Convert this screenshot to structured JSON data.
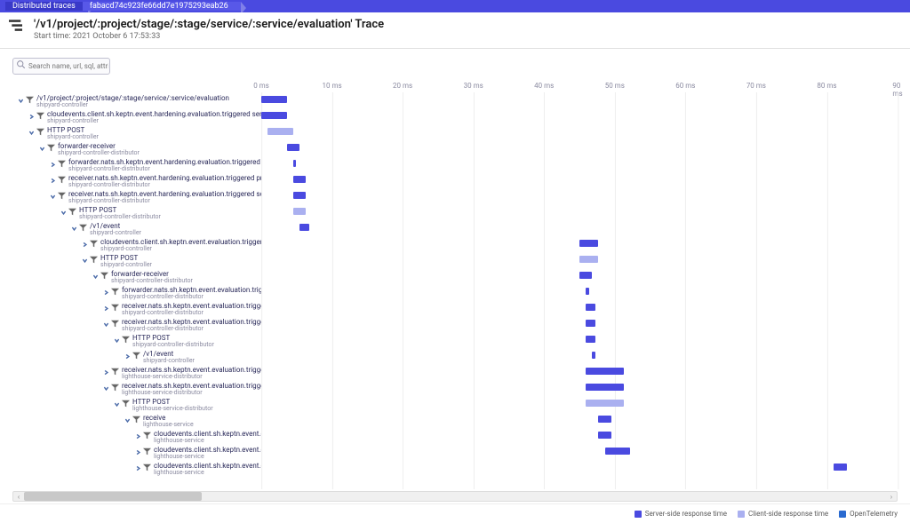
{
  "breadcrumb": {
    "item1": "Distributed traces",
    "item2": "fabacd74c923fe66dd7e1975293eab26"
  },
  "header": {
    "title": "'/v1/project/:project/stage/:stage/service/:service/evaluation' Trace",
    "subtitle": "Start time: 2021 October 6 17:53:33"
  },
  "search": {
    "placeholder": "Search name, url, sql, attribute,..."
  },
  "ticks": [
    "0 ms",
    "10 ms",
    "20 ms",
    "30 ms",
    "40 ms",
    "50 ms",
    "60 ms",
    "70 ms",
    "80 ms",
    "90 ms"
  ],
  "legend": {
    "server": "Server-side response time",
    "client": "Client-side response time",
    "otel": "OpenTelemetry"
  },
  "colors": {
    "server": "#4a4ae0",
    "client": "#aab0f0",
    "otel": "#2a6ad0"
  },
  "chart_data": {
    "type": "table",
    "unit": "ms",
    "xrange": [
      0,
      100
    ],
    "rows": [
      {
        "depth": 0,
        "name": "/v1/project/:project/stage/:stage/service/:service/evaluation",
        "svc": "shipyard-controller",
        "start": 0,
        "dur": 4,
        "kind": "server"
      },
      {
        "depth": 1,
        "name": "cloudevents.client.sh.keptn.event.hardening.evaluation.triggered send",
        "svc": "shipyard-controller",
        "start": 0,
        "dur": 4,
        "kind": "server"
      },
      {
        "depth": 1,
        "name": "HTTP POST",
        "svc": "shipyard-controller",
        "start": 1,
        "dur": 4,
        "kind": "client"
      },
      {
        "depth": 2,
        "name": "forwarder-receiver",
        "svc": "shipyard-controller-distributor",
        "start": 4,
        "dur": 2,
        "kind": "server"
      },
      {
        "depth": 3,
        "name": "forwarder.nats.sh.keptn.event.hardening.evaluation.triggered send",
        "svc": "shipyard-controller-distributor",
        "start": 5,
        "dur": 0.5,
        "kind": "server"
      },
      {
        "depth": 3,
        "name": "receiver.nats.sh.keptn.event.hardening.evaluation.triggered process",
        "svc": "shipyard-controller-distributor",
        "start": 5,
        "dur": 2,
        "kind": "server"
      },
      {
        "depth": 3,
        "name": "receiver.nats.sh.keptn.event.hardening.evaluation.triggered send",
        "svc": "shipyard-controller-distributor",
        "start": 5,
        "dur": 2,
        "kind": "server"
      },
      {
        "depth": 4,
        "name": "HTTP POST",
        "svc": "shipyard-controller-distributor",
        "start": 5,
        "dur": 2,
        "kind": "client"
      },
      {
        "depth": 5,
        "name": "/v1/event",
        "svc": "shipyard-controller",
        "start": 6,
        "dur": 1.5,
        "kind": "server"
      },
      {
        "depth": 6,
        "name": "cloudevents.client.sh.keptn.event.evaluation.triggered send",
        "svc": "shipyard-controller",
        "start": 50,
        "dur": 3,
        "kind": "server"
      },
      {
        "depth": 6,
        "name": "HTTP POST",
        "svc": "shipyard-controller",
        "start": 50,
        "dur": 3,
        "kind": "client"
      },
      {
        "depth": 7,
        "name": "forwarder-receiver",
        "svc": "shipyard-controller-distributor",
        "start": 50,
        "dur": 2,
        "kind": "server"
      },
      {
        "depth": 8,
        "name": "forwarder.nats.sh.keptn.event.evaluation.triggered send",
        "svc": "shipyard-controller-distributor",
        "start": 51,
        "dur": 0.5,
        "kind": "server"
      },
      {
        "depth": 8,
        "name": "receiver.nats.sh.keptn.event.evaluation.triggered process",
        "svc": "shipyard-controller-distributor",
        "start": 51,
        "dur": 1.5,
        "kind": "server"
      },
      {
        "depth": 8,
        "name": "receiver.nats.sh.keptn.event.evaluation.triggered send",
        "svc": "shipyard-controller-distributor",
        "start": 51,
        "dur": 1.5,
        "kind": "server"
      },
      {
        "depth": 9,
        "name": "HTTP POST",
        "svc": "shipyard-controller-distributor",
        "start": 51,
        "dur": 1.5,
        "kind": "server"
      },
      {
        "depth": 10,
        "name": "/v1/event",
        "svc": "shipyard-controller",
        "start": 52,
        "dur": 0.5,
        "kind": "server"
      },
      {
        "depth": 8,
        "name": "receiver.nats.sh.keptn.event.evaluation.triggered process",
        "svc": "lighthouse-service-distributor",
        "start": 51,
        "dur": 6,
        "kind": "server"
      },
      {
        "depth": 8,
        "name": "receiver.nats.sh.keptn.event.evaluation.triggered send",
        "svc": "lighthouse-service-distributor",
        "start": 51,
        "dur": 6,
        "kind": "server"
      },
      {
        "depth": 9,
        "name": "HTTP POST",
        "svc": "lighthouse-service-distributor",
        "start": 51,
        "dur": 6,
        "kind": "client"
      },
      {
        "depth": 10,
        "name": "receive",
        "svc": "lighthouse-service",
        "start": 53,
        "dur": 2,
        "kind": "server"
      },
      {
        "depth": 11,
        "name": "cloudevents.client.sh.keptn.event.evaluation.triggered receive",
        "svc": "lighthouse-service",
        "start": 53,
        "dur": 2,
        "kind": "server"
      },
      {
        "depth": 11,
        "name": "cloudevents.client.sh.keptn.event.evaluation.started send",
        "svc": "lighthouse-service",
        "start": 54,
        "dur": 4,
        "kind": "server"
      },
      {
        "depth": 11,
        "name": "cloudevents.client.sh.keptn.event.get-sli.triggered send",
        "svc": "lighthouse-service",
        "start": 90,
        "dur": 2,
        "kind": "server"
      }
    ]
  }
}
